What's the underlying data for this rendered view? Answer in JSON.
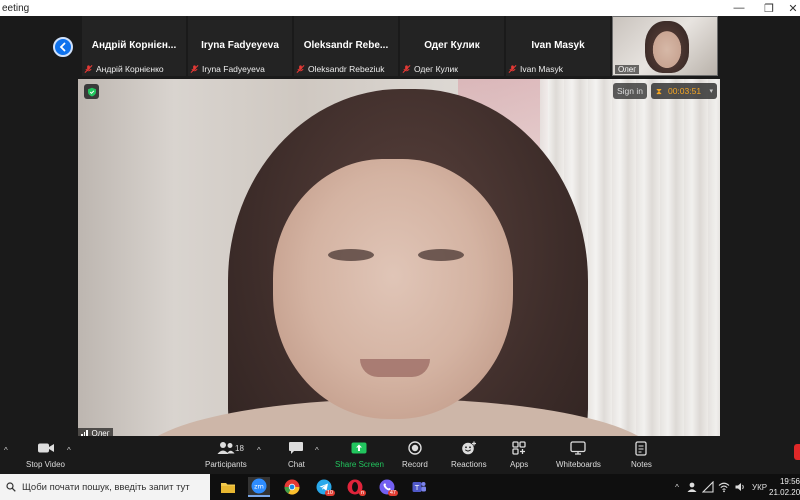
{
  "window": {
    "title": "eeting"
  },
  "participants": [
    {
      "name": "Андрій Корнієн...",
      "label": "Андрій Корнієнко"
    },
    {
      "name": "Iryna Fadyeyeva",
      "label": "Iryna Fadyeyeva"
    },
    {
      "name": "Oleksandr Rebe...",
      "label": "Oleksandr Rebeziuk"
    },
    {
      "name": "Одег Кулик",
      "label": "Одег Кулик"
    },
    {
      "name": "Ivan Masyk",
      "label": "Ivan Masyk"
    }
  ],
  "self_tile": {
    "label": "Олег"
  },
  "main_video": {
    "speaker_label": "Олег",
    "signin_label": "Sign in",
    "timer": "00:03:51"
  },
  "toolbar": {
    "stop_video": "Stop Video",
    "participants": "Participants",
    "participants_count": "18",
    "chat": "Chat",
    "share_screen": "Share Screen",
    "record": "Record",
    "reactions": "Reactions",
    "apps": "Apps",
    "whiteboards": "Whiteboards",
    "notes": "Notes"
  },
  "taskbar": {
    "search_placeholder": "Щоби почати пошук, введіть запит тут",
    "telegram_badge": "10",
    "opera_badge": "n",
    "viber_badge": "47",
    "language": "УКР",
    "time": "19:56",
    "date": "21.02.20"
  },
  "colors": {
    "accent": "#0e72ed",
    "share_green": "#22c55e",
    "timer_orange": "#f5a623"
  }
}
